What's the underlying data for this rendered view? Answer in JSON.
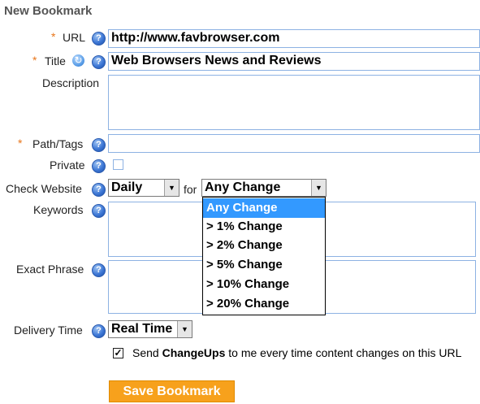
{
  "form": {
    "title": "New Bookmark",
    "required_marker": "*",
    "help_glyph": "?",
    "url": {
      "label": "URL",
      "value": "http://www.favbrowser.com"
    },
    "title_field": {
      "label": "Title",
      "value": "Web Browsers News and Reviews"
    },
    "description": {
      "label": "Description",
      "value": ""
    },
    "path_tags": {
      "label": "Path/Tags",
      "value": ""
    },
    "private": {
      "label": "Private",
      "checked": false
    },
    "check_website": {
      "label": "Check Website",
      "frequency": "Daily",
      "for_text": "for",
      "change": "Any Change",
      "change_options": [
        "Any Change",
        "> 1% Change",
        "> 2% Change",
        "> 5% Change",
        "> 10% Change",
        "> 20% Change"
      ],
      "selected_index": 0
    },
    "keywords": {
      "label": "Keywords",
      "value": ""
    },
    "exact_phrase": {
      "label": "Exact Phrase",
      "value": ""
    },
    "delivery_time": {
      "label": "Delivery Time",
      "value": "Real Time"
    },
    "notify": {
      "checked": true,
      "text_before": "Send ",
      "text_bold": "ChangeUps",
      "text_after": " to me every time content changes on this URL"
    },
    "save_label": "Save Bookmark"
  },
  "colors": {
    "accent_orange": "#f7a11c",
    "field_border": "#8db2e3",
    "selection_blue": "#3399ff",
    "help_icon_blue": "#3e78d6"
  }
}
